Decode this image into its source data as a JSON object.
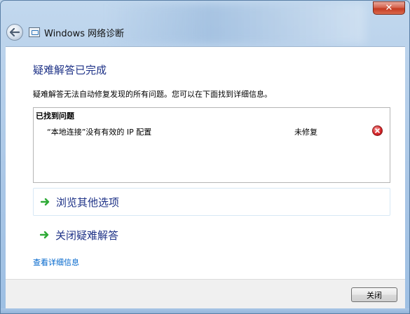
{
  "window": {
    "title": "Windows 网络诊断",
    "close_glyph": "✕"
  },
  "main": {
    "heading": "疑难解答已完成",
    "description": "疑难解答无法自动修复发现的所有问题。您可以在下面找到详细信息。"
  },
  "problems": {
    "header": "已找到问题",
    "items": [
      {
        "text": "“本地连接”没有有效的 IP 配置",
        "status": "未修复",
        "status_icon": "error-icon"
      }
    ]
  },
  "options": [
    {
      "label": "浏览其他选项",
      "icon": "green-arrow-icon"
    },
    {
      "label": "关闭疑难解答",
      "icon": "green-arrow-icon"
    }
  ],
  "links": {
    "details": "查看详细信息"
  },
  "footer": {
    "close_label": "关闭"
  },
  "colors": {
    "heading": "#1e3287",
    "link": "#0066cc",
    "arrow": "#2eaa36",
    "error": "#d8262a"
  }
}
